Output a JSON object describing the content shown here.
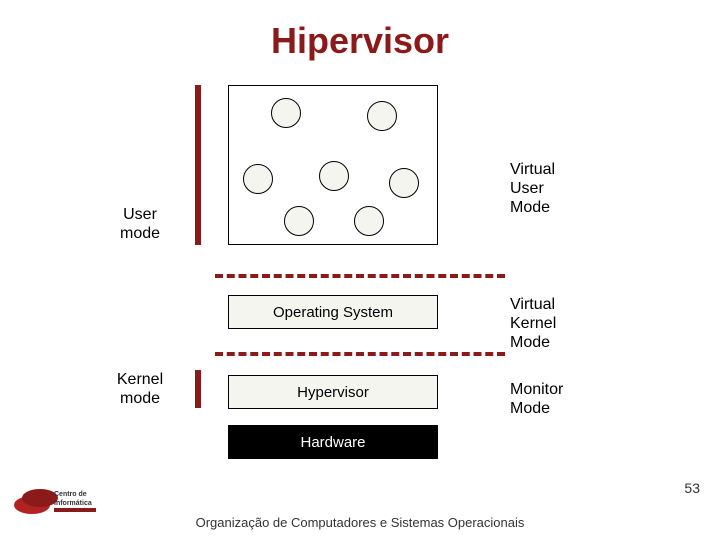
{
  "title": "Hipervisor",
  "labels": {
    "user_mode": "User\nmode",
    "kernel_mode": "Kernel\nmode",
    "virtual_user_mode": "Virtual\nUser\nMode",
    "virtual_kernel_mode": "Virtual\nKernel\nMode",
    "monitor_mode": "Monitor\nMode"
  },
  "boxes": {
    "os": "Operating System",
    "hypervisor": "Hypervisor",
    "hardware": "Hardware"
  },
  "footer": "Organização de Computadores e Sistemas Operacionais",
  "page_number": "53",
  "colors": {
    "accent": "#8b1a1a"
  }
}
